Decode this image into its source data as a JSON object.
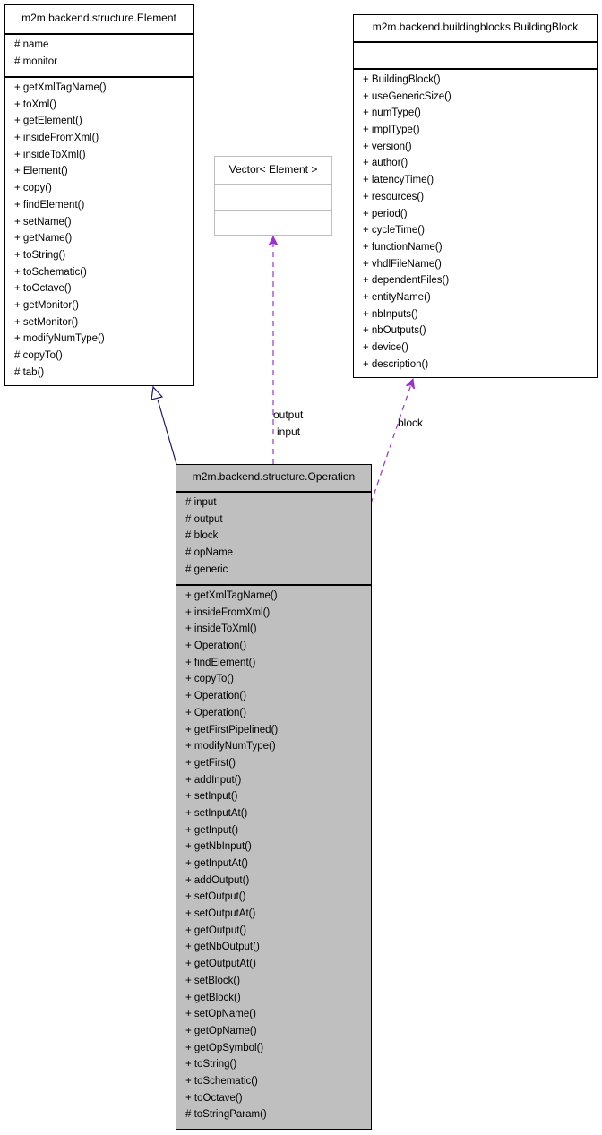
{
  "diagram": {
    "type": "uml-collaboration",
    "colors": {
      "inheritance_edge": "#1a1a6e",
      "usage_edge": "#9a32cd",
      "focus_class_fill": "#bfbfbf",
      "external_class_border": "#bdbdbd"
    },
    "classes": {
      "element": {
        "name": "m2m.backend.structure.Element",
        "attributes": [
          "# name",
          "# monitor"
        ],
        "methods": [
          "+ getXmlTagName()",
          "+ toXml()",
          "+ getElement()",
          "+ insideFromXml()",
          "+ insideToXml()",
          "+ Element()",
          "+ copy()",
          "+ findElement()",
          "+ setName()",
          "+ getName()",
          "+ toString()",
          "+ toSchematic()",
          "+ toOctave()",
          "+ getMonitor()",
          "+ setMonitor()",
          "+ modifyNumType()",
          "# copyTo()",
          "# tab()"
        ]
      },
      "vector": {
        "name": "Vector< Element >",
        "attributes": [],
        "methods": []
      },
      "building_block": {
        "name": "m2m.backend.buildingblocks.BuildingBlock",
        "attributes": [],
        "methods": [
          "+ BuildingBlock()",
          "+ useGenericSize()",
          "+ numType()",
          "+ implType()",
          "+ version()",
          "+ author()",
          "+ latencyTime()",
          "+ resources()",
          "+ period()",
          "+ cycleTime()",
          "+ functionName()",
          "+ vhdlFileName()",
          "+ dependentFiles()",
          "+ entityName()",
          "+ nbInputs()",
          "+ nbOutputs()",
          "+ device()",
          "+ description()"
        ]
      },
      "operation": {
        "name": "m2m.backend.structure.Operation",
        "attributes": [
          "# input",
          "# output",
          "# block",
          "# opName",
          "# generic"
        ],
        "methods": [
          "+ getXmlTagName()",
          "+ insideFromXml()",
          "+ insideToXml()",
          "+ Operation()",
          "+ findElement()",
          "+ copyTo()",
          "+ Operation()",
          "+ Operation()",
          "+ getFirstPipelined()",
          "+ modifyNumType()",
          "+ getFirst()",
          "+ addInput()",
          "+ setInput()",
          "+ setInputAt()",
          "+ getInput()",
          "+ getNbInput()",
          "+ getInputAt()",
          "+ addOutput()",
          "+ setOutput()",
          "+ setOutputAt()",
          "+ getOutput()",
          "+ getNbOutput()",
          "+ getOutputAt()",
          "+ setBlock()",
          "+ getBlock()",
          "+ setOpName()",
          "+ getOpName()",
          "+ getOpSymbol()",
          "+ toString()",
          "+ toSchematic()",
          "+ toOctave()",
          "# toStringParam()"
        ]
      }
    },
    "edges": {
      "inheritance": {
        "from": "Operation",
        "to": "Element",
        "kind": "inheritance"
      },
      "vector_usage": {
        "from": "Operation",
        "to": "Vector< Element >",
        "kind": "usage",
        "labels": [
          "output",
          "input"
        ]
      },
      "block_usage": {
        "from": "Operation",
        "to": "BuildingBlock",
        "kind": "usage",
        "labels": [
          "block"
        ]
      }
    }
  }
}
